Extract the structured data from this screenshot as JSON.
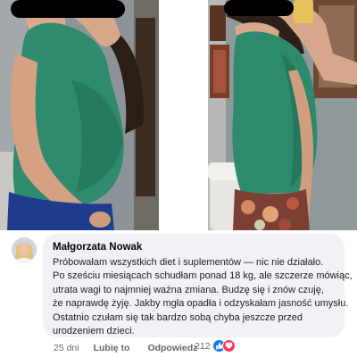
{
  "comment": {
    "author": "Małgorzata Nowak",
    "text_lines": [
      "Próbowałam wszystkich diet i suplementów — nic nie działało.",
      "Po sześciu miesiącach schudłam ponad 18 kg, ale szczerze mówiąc,",
      "utrata wagi to najmniej ważna zmiana. Budzę się i znów czuję,",
      "że naprawdę żyję. Jakby mgła opadła i odzyskałam jasność umysłu.",
      "Ostatnio czułam się tak bardzo sobą chyba jeszcze przed",
      "urodzeniem dzieci."
    ],
    "time": "25 dni",
    "like_label": "Lubię to",
    "reply_label": "Odpowiedz",
    "reaction_count": "212",
    "reaction_icons": [
      "like-icon",
      "love-icon"
    ]
  },
  "colors": {
    "bubble": "#f0f2f5",
    "link_blue": "#1877f2",
    "love_red": "#f33e58",
    "meta_gray": "#65676b"
  }
}
